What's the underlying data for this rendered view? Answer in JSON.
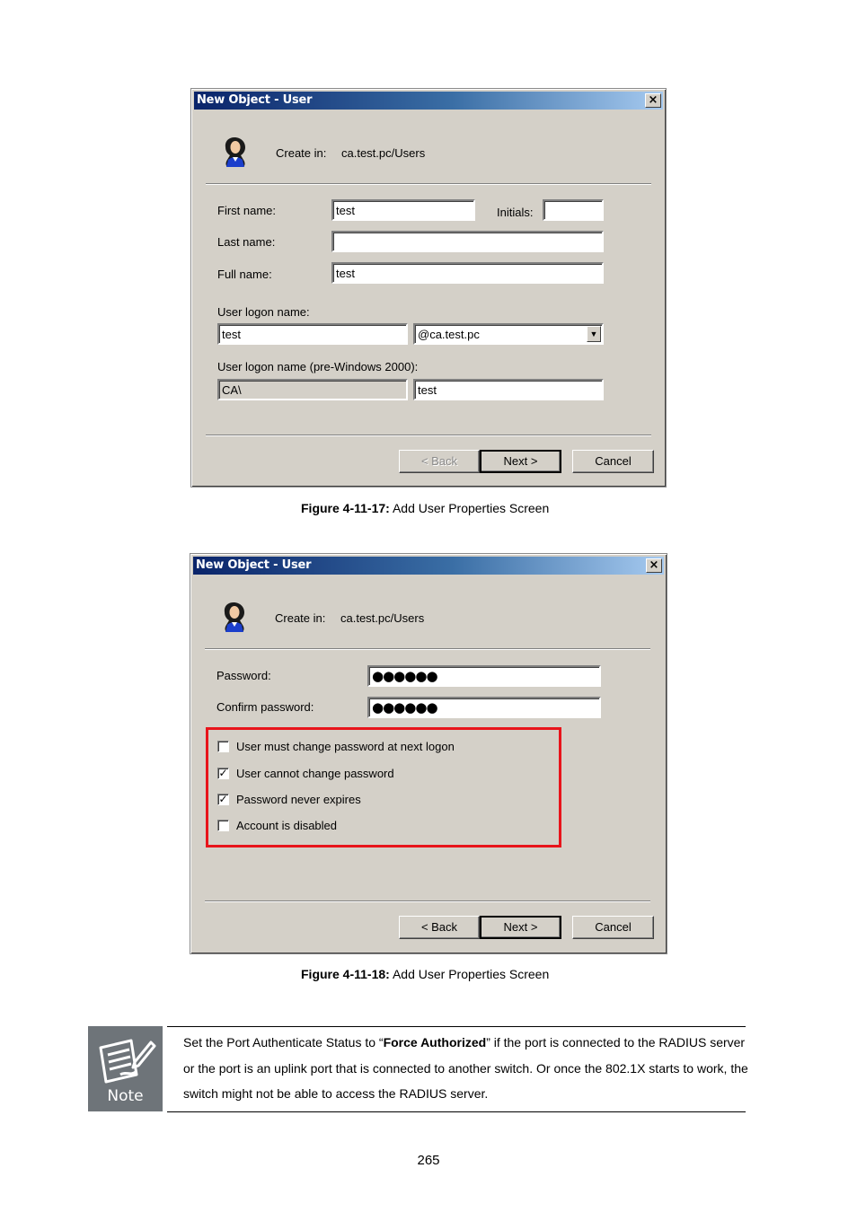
{
  "dialog1": {
    "title": "New Object - User",
    "create_in_label": "Create in:",
    "create_in_value": "ca.test.pc/Users",
    "first_name_label": "First name:",
    "first_name_value": "test",
    "initials_label": "Initials:",
    "initials_value": "",
    "last_name_label": "Last name:",
    "last_name_value": "",
    "full_name_label": "Full name:",
    "full_name_value": "test",
    "logon_name_label": "User logon name:",
    "logon_name_value": "test",
    "domain_value": "@ca.test.pc",
    "pre2000_label": "User logon name (pre-Windows 2000):",
    "pre2000_domain": "CA\\",
    "pre2000_value": "test",
    "back_label": "< Back",
    "next_label": "Next >",
    "cancel_label": "Cancel"
  },
  "caption1": {
    "bold": "Figure 4-11-17:",
    "text": " Add User Properties Screen"
  },
  "dialog2": {
    "title": "New Object - User",
    "create_in_label": "Create in:",
    "create_in_value": "ca.test.pc/Users",
    "password_label": "Password:",
    "password_value": "●●●●●●",
    "confirm_label": "Confirm password:",
    "confirm_value": "●●●●●●",
    "options": [
      {
        "label": "User must change password at next logon",
        "checked": false
      },
      {
        "label": "User cannot change password",
        "checked": true
      },
      {
        "label": "Password never expires",
        "checked": true
      },
      {
        "label": "Account is disabled",
        "checked": false
      }
    ],
    "back_label": "< Back",
    "next_label": "Next >",
    "cancel_label": "Cancel"
  },
  "caption2": {
    "bold": "Figure 4-11-18:",
    "text": " Add User Properties Screen"
  },
  "note": {
    "icon_label": "Note",
    "text_before": "Set the Port Authenticate Status to “",
    "text_bold": "Force Authorized",
    "text_after": "” if the port is connected to the RADIUS server or the port is an uplink port that is connected to another switch. Or once the 802.1X starts to work, the switch might not be able to access the RADIUS server."
  },
  "page_number": "265",
  "colors": {
    "highlight_box": "#e8141b",
    "title_bar": "#0a246a",
    "dialog_face": "#d4d0c8"
  }
}
